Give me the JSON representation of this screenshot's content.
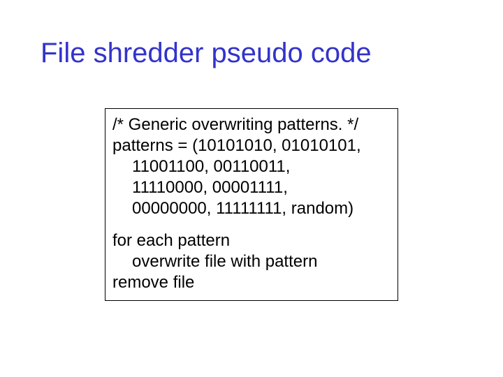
{
  "title": "File shredder pseudo code",
  "code": {
    "block1": {
      "l1": "/* Generic overwriting patterns. */",
      "l2": "patterns = (10101010, 01010101,",
      "l3": "11001100, 00110011,",
      "l4": "11110000, 00001111,",
      "l5": "00000000, 11111111, random)"
    },
    "block2": {
      "l1": "for each pattern",
      "l2": "overwrite file with pattern",
      "l3": "remove file"
    }
  }
}
